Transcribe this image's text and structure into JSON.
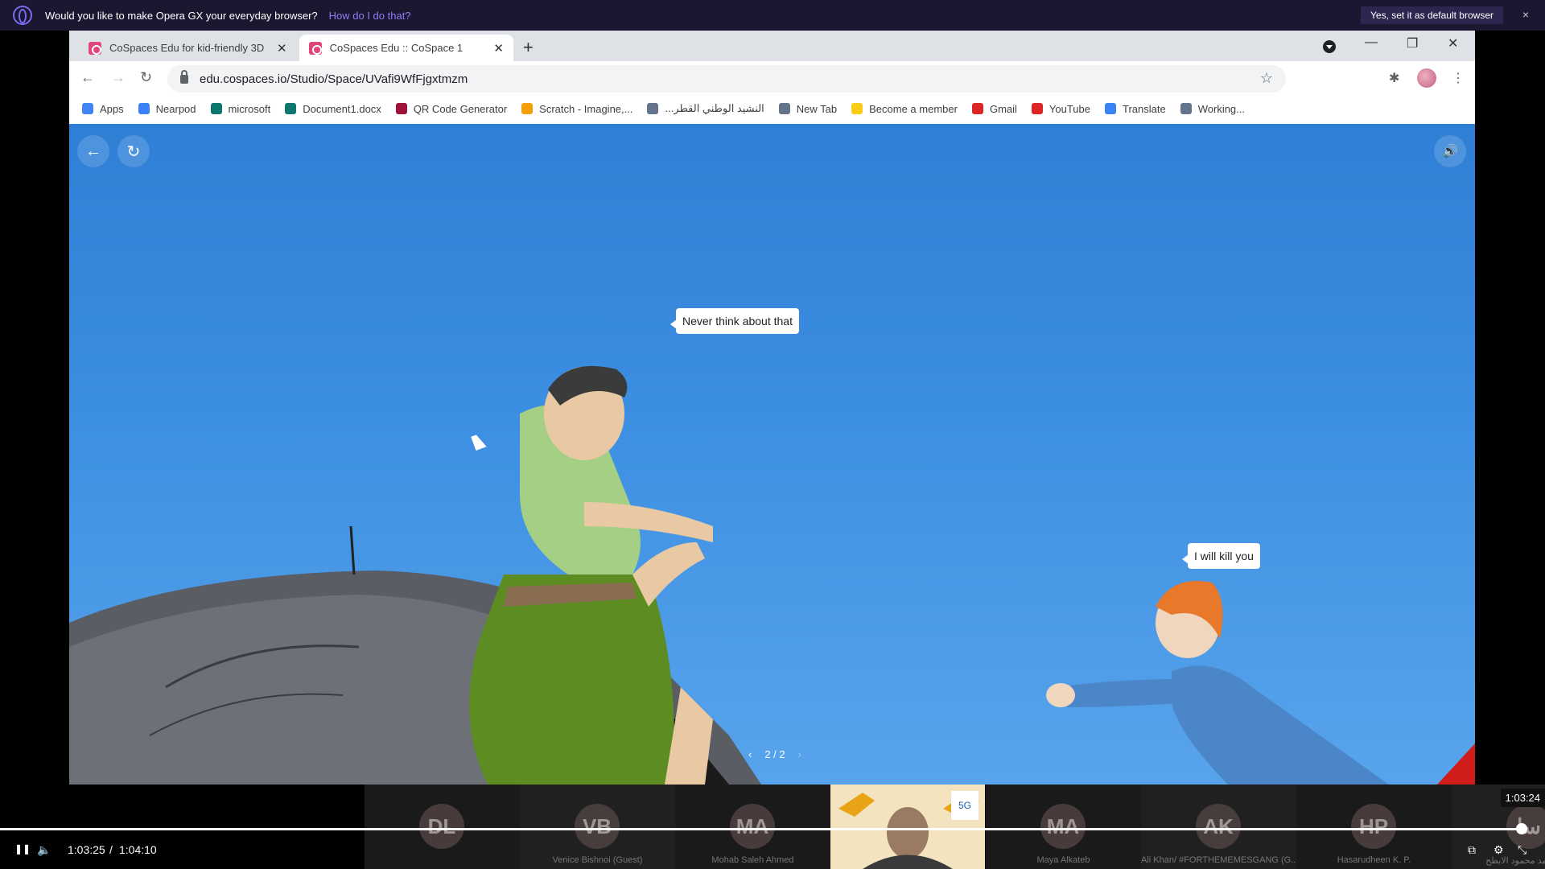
{
  "opera_bar": {
    "message": "Would you like to make Opera GX your everyday browser?",
    "link": "How do I do that?",
    "default_button": "Yes, set it as default browser",
    "close": "×"
  },
  "tabs": [
    {
      "title": "CoSpaces Edu for kid-friendly 3D",
      "close": "✕"
    },
    {
      "title": "CoSpaces Edu :: CoSpace 1",
      "close": "✕"
    }
  ],
  "new_tab": "+",
  "window_controls": {
    "minimize": "—",
    "restore": "❐",
    "close": "✕"
  },
  "toolbar": {
    "back": "←",
    "forward": "→",
    "reload": "↻",
    "url": "edu.cospaces.io/Studio/Space/UVafi9WfFjgxtmzm",
    "star": "☆",
    "extensions": "✱",
    "menu": "⋮"
  },
  "bookmarks": [
    {
      "label": "Apps",
      "color": "#4285f4"
    },
    {
      "label": "Nearpod",
      "color": "#3b82f6"
    },
    {
      "label": "microsoft",
      "color": "#0f766e"
    },
    {
      "label": "Document1.docx",
      "color": "#0f766e"
    },
    {
      "label": "QR Code Generator",
      "color": "#9f1239"
    },
    {
      "label": "Scratch - Imagine,...",
      "color": "#f59e0b"
    },
    {
      "label": "...النشيد الوطني القطر",
      "color": "#64748b"
    },
    {
      "label": "New Tab",
      "color": "#64748b"
    },
    {
      "label": "Become a member",
      "color": "#facc15"
    },
    {
      "label": "Gmail",
      "color": "#dc2626"
    },
    {
      "label": "YouTube",
      "color": "#dc2626"
    },
    {
      "label": "Translate",
      "color": "#3b82f6"
    },
    {
      "label": "Working...",
      "color": "#64748b"
    }
  ],
  "viewport": {
    "back_icon": "←",
    "reset_icon": "↻",
    "sound_icon": "🔊",
    "bubble_1": "Never think about that",
    "bubble_2": "I will kill you",
    "pager_prev": "‹",
    "pager_text": "2 / 2",
    "pager_next": "›"
  },
  "participants": [
    {
      "initials": "DL",
      "name": ""
    },
    {
      "initials": "VB",
      "name": "Venice Bishnoi (Guest)"
    },
    {
      "initials": "MA",
      "name": "Mohab    Saleh Ahmed"
    },
    {
      "initials": "",
      "name": ""
    },
    {
      "initials": "MA",
      "name": "Maya Alkateb"
    },
    {
      "initials": "AK",
      "name": "Ali Khan/ #FORTHEMEMESGANG (G..."
    },
    {
      "initials": "HP",
      "name": "Hasarudheen K. P."
    },
    {
      "initials": "سا",
      "name": "سبا محمد محمود الابطح"
    }
  ],
  "player": {
    "play_pause": "❚❚",
    "volume": "🔈",
    "current_time": "1:03:25",
    "separator": "/",
    "total_time": "1:04:10",
    "hover_time": "1:03:24",
    "progress_fraction": 0.985,
    "cc": "⧉",
    "settings": "⚙",
    "fullscreen": "⤡"
  }
}
